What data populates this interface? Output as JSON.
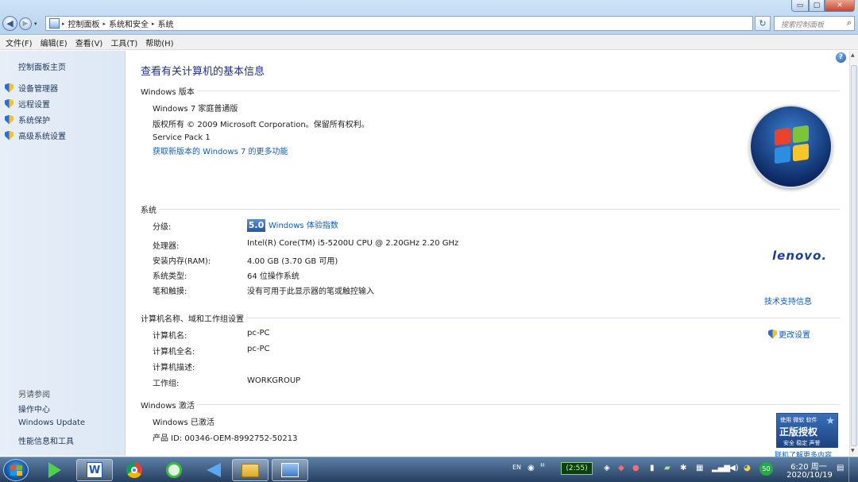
{
  "window": {
    "min_glyph": "▭",
    "max_glyph": "▢",
    "close_glyph": "✕"
  },
  "nav": {
    "back_glyph": "◀",
    "forward_glyph": "▶",
    "dropdown_glyph": "▾"
  },
  "address": {
    "crumbs": [
      "控制面板",
      "系统和安全",
      "系统"
    ],
    "separator": "▸",
    "dropdown_glyph": "▾",
    "refresh_glyph": "↻",
    "search_placeholder": "搜索控制面板",
    "search_glyph": "⌕"
  },
  "menu": [
    "文件(F)",
    "编辑(E)",
    "查看(V)",
    "工具(T)",
    "帮助(H)"
  ],
  "sidebar": {
    "home": "控制面板主页",
    "tasks": [
      "设备管理器",
      "远程设置",
      "系统保护",
      "高级系统设置"
    ],
    "see_also_title": "另请参阅",
    "see_also": [
      "操作中心",
      "Windows Update",
      "性能信息和工具"
    ]
  },
  "main": {
    "help_glyph": "?",
    "title": "查看有关计算机的基本信息",
    "edition": {
      "header": "Windows 版本",
      "name": "Windows 7 家庭普通版",
      "copyright": "版权所有 © 2009 Microsoft Corporation。保留所有权利。",
      "service_pack": "Service Pack 1",
      "more_link": "获取新版本的 Windows 7 的更多功能"
    },
    "system": {
      "header": "系统",
      "rating_label": "分级:",
      "rating_score": "5.0",
      "rating_link": "Windows 体验指数",
      "processor_label": "处理器:",
      "processor_value": "Intel(R) Core(TM) i5-5200U CPU @ 2.20GHz   2.20 GHz",
      "ram_label": "安装内存(RAM):",
      "ram_value": "4.00 GB (3.70 GB 可用)",
      "type_label": "系统类型:",
      "type_value": "64 位操作系统",
      "pen_label": "笔和触摸:",
      "pen_value": "没有可用于此显示器的笔或触控输入",
      "oem_logo_text": "lenovo.",
      "support_link": "技术支持信息"
    },
    "computer": {
      "header": "计算机名称、域和工作组设置",
      "name_label": "计算机名:",
      "name_value": "pc-PC",
      "fullname_label": "计算机全名:",
      "fullname_value": "pc-PC",
      "desc_label": "计算机描述:",
      "workgroup_label": "工作组:",
      "workgroup_value": "WORKGROUP",
      "change_link": "更改设置"
    },
    "activation": {
      "header": "Windows 激活",
      "status": "Windows 已激活",
      "product_id": "产品 ID: 00346-OEM-8992752-50213",
      "badge_top": "使用 微软 软件",
      "badge_main": "正版授权",
      "badge_sub": "安全 稳定 声誉",
      "learn_link": "联机了解更多内容..."
    }
  },
  "taskbar": {
    "apps": [
      "media-player",
      "word",
      "chrome",
      "ie",
      "feishu",
      "explorer",
      "control-panel"
    ],
    "word_glyph": "W",
    "lang": "EN",
    "battery": "(2:55)",
    "badge_50": "50",
    "clock_time": "6:20 周一",
    "clock_date": "2020/10/19"
  }
}
